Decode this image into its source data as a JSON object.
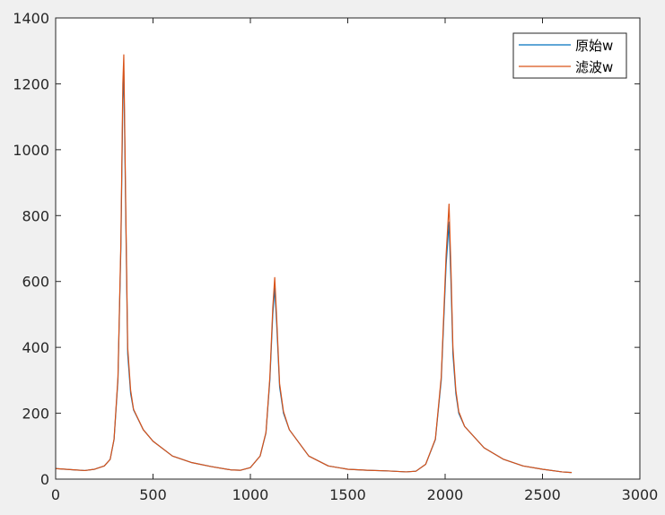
{
  "chart_data": {
    "type": "line",
    "title": "",
    "xlabel": "",
    "ylabel": "",
    "xlim": [
      0,
      3000
    ],
    "ylim": [
      0,
      1400
    ],
    "xticks": [
      0,
      500,
      1000,
      1500,
      2000,
      2500,
      3000
    ],
    "yticks": [
      0,
      200,
      400,
      600,
      800,
      1000,
      1200,
      1400
    ],
    "xtick_labels": [
      "0",
      "500",
      "1000",
      "1500",
      "2000",
      "2500",
      "3000"
    ],
    "ytick_labels": [
      "0",
      "200",
      "400",
      "600",
      "800",
      "1000",
      "1200",
      "1400"
    ],
    "grid": false,
    "legend_position": "top-right",
    "series": [
      {
        "name": "原始w",
        "color": "#0072bd",
        "x": [
          0,
          50,
          100,
          150,
          200,
          250,
          280,
          300,
          320,
          335,
          345,
          350,
          360,
          370,
          385,
          400,
          450,
          500,
          600,
          700,
          800,
          900,
          950,
          1000,
          1050,
          1080,
          1100,
          1115,
          1125,
          1135,
          1150,
          1170,
          1200,
          1300,
          1400,
          1500,
          1600,
          1700,
          1800,
          1850,
          1900,
          1950,
          1980,
          2005,
          2020,
          2030,
          2040,
          2055,
          2070,
          2100,
          2200,
          2300,
          2400,
          2500,
          2600,
          2650
        ],
        "y": [
          32,
          30,
          28,
          26,
          30,
          40,
          60,
          120,
          300,
          700,
          1150,
          1240,
          800,
          380,
          260,
          210,
          150,
          115,
          70,
          50,
          38,
          28,
          27,
          35,
          70,
          140,
          300,
          500,
          580,
          470,
          280,
          200,
          150,
          70,
          40,
          30,
          27,
          25,
          22,
          24,
          45,
          120,
          300,
          650,
          780,
          600,
          380,
          260,
          200,
          160,
          95,
          60,
          40,
          30,
          22,
          20
        ]
      },
      {
        "name": "滤波w",
        "color": "#d95319",
        "x": [
          0,
          50,
          100,
          150,
          200,
          250,
          280,
          300,
          320,
          335,
          345,
          350,
          360,
          370,
          385,
          400,
          450,
          500,
          600,
          700,
          800,
          900,
          950,
          1000,
          1050,
          1080,
          1100,
          1115,
          1125,
          1135,
          1150,
          1170,
          1200,
          1300,
          1400,
          1500,
          1600,
          1700,
          1800,
          1850,
          1900,
          1950,
          1980,
          2005,
          2020,
          2030,
          2040,
          2055,
          2070,
          2100,
          2200,
          2300,
          2400,
          2500,
          2600,
          2650
        ],
        "y": [
          32,
          30,
          28,
          26,
          30,
          40,
          60,
          122,
          310,
          720,
          1200,
          1288,
          830,
          400,
          270,
          212,
          150,
          115,
          70,
          50,
          38,
          28,
          27,
          35,
          70,
          142,
          310,
          520,
          612,
          490,
          290,
          205,
          150,
          70,
          40,
          30,
          27,
          25,
          22,
          24,
          45,
          122,
          310,
          680,
          835,
          640,
          400,
          270,
          205,
          160,
          95,
          60,
          40,
          30,
          22,
          20
        ]
      }
    ]
  }
}
